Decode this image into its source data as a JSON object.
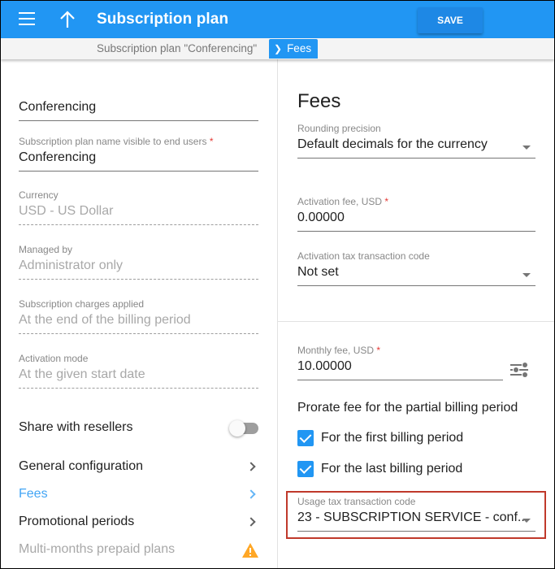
{
  "appbar": {
    "title": "Subscription plan",
    "save_label": "SAVE",
    "colors": {
      "primary": "#2196f3",
      "save": "#1e88e5"
    }
  },
  "breadcrumb": {
    "items": [
      "Subscription plan \"Conferencing\"",
      "Fees"
    ],
    "separator": "›"
  },
  "left": {
    "plan_name": {
      "value": "Conferencing"
    },
    "visible_name": {
      "label": "Subscription plan name visible to end users",
      "required": "*",
      "value": "Conferencing"
    },
    "currency": {
      "label": "Currency",
      "value": "USD - US Dollar"
    },
    "managed_by": {
      "label": "Managed by",
      "value": "Administrator only"
    },
    "charges_applied": {
      "label": "Subscription charges applied",
      "value": "At the end of the billing period"
    },
    "activation_mode": {
      "label": "Activation mode",
      "value": "At the given start date"
    },
    "share": {
      "label": "Share with resellers",
      "enabled": false
    },
    "nav": [
      {
        "label": "General configuration",
        "state": "normal"
      },
      {
        "label": "Fees",
        "state": "active"
      },
      {
        "label": "Promotional periods",
        "state": "normal"
      },
      {
        "label": "Multi-months prepaid plans",
        "state": "warning"
      }
    ]
  },
  "right": {
    "heading": "Fees",
    "rounding": {
      "label": "Rounding precision",
      "value": "Default decimals for the currency"
    },
    "activation_fee": {
      "label": "Activation fee, USD",
      "required": "*",
      "value": "0.00000"
    },
    "activation_tax": {
      "label": "Activation tax transaction code",
      "value": "Not set"
    },
    "monthly_fee": {
      "label": "Monthly fee, USD",
      "required": "*",
      "value": "10.00000"
    },
    "prorate": {
      "title": "Prorate fee for the partial billing period",
      "options": [
        {
          "label": "For the first billing period",
          "checked": true
        },
        {
          "label": "For the last billing period",
          "checked": true
        }
      ]
    },
    "usage_tax": {
      "label": "Usage tax transaction code",
      "value": "23 - SUBSCRIPTION SERVICE - conf..."
    }
  }
}
